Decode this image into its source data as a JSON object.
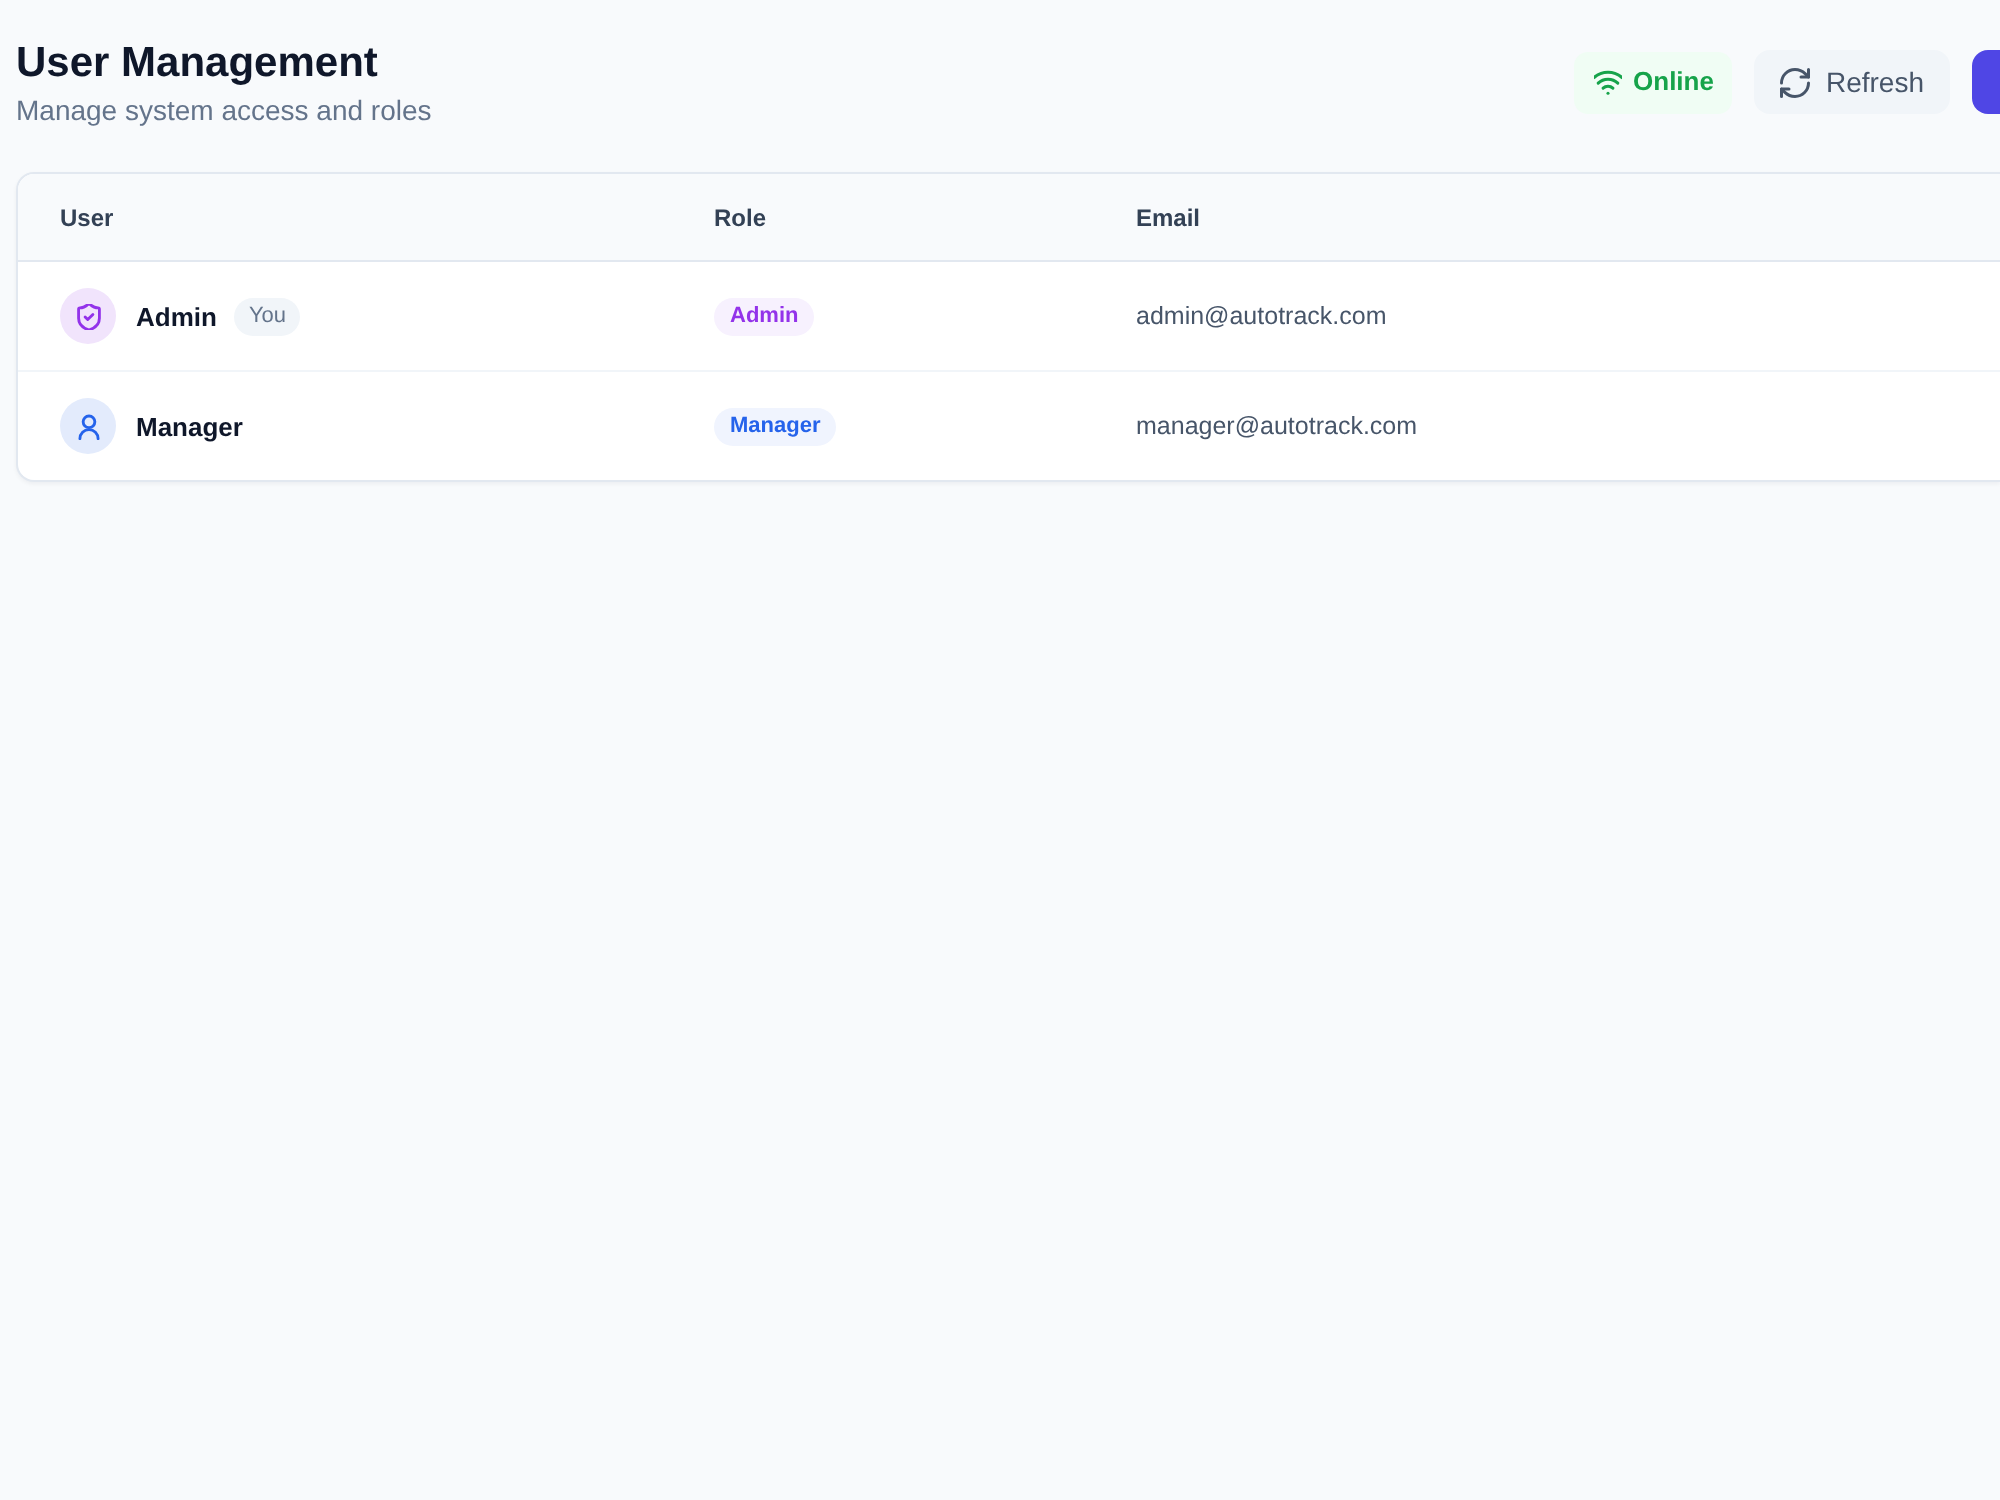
{
  "header": {
    "title": "User Management",
    "subtitle": "Manage system access and roles"
  },
  "status": {
    "label": "Online",
    "connected": true
  },
  "actions": [
    {
      "kind": "refresh",
      "label": "Refresh"
    },
    {
      "kind": "primary"
    }
  ],
  "table": {
    "columns": [
      "User",
      "Role",
      "Email"
    ],
    "rows": [
      {
        "kind": "admin",
        "name": "Admin",
        "badge": "You",
        "role": {
          "label": "Admin",
          "color": "#9333ea"
        },
        "email": "admin@autotrack.com"
      },
      {
        "kind": "manager",
        "name": "Manager",
        "role": {
          "label": "Manager",
          "color": "#2563eb"
        },
        "email": "manager@autotrack.com"
      }
    ]
  }
}
